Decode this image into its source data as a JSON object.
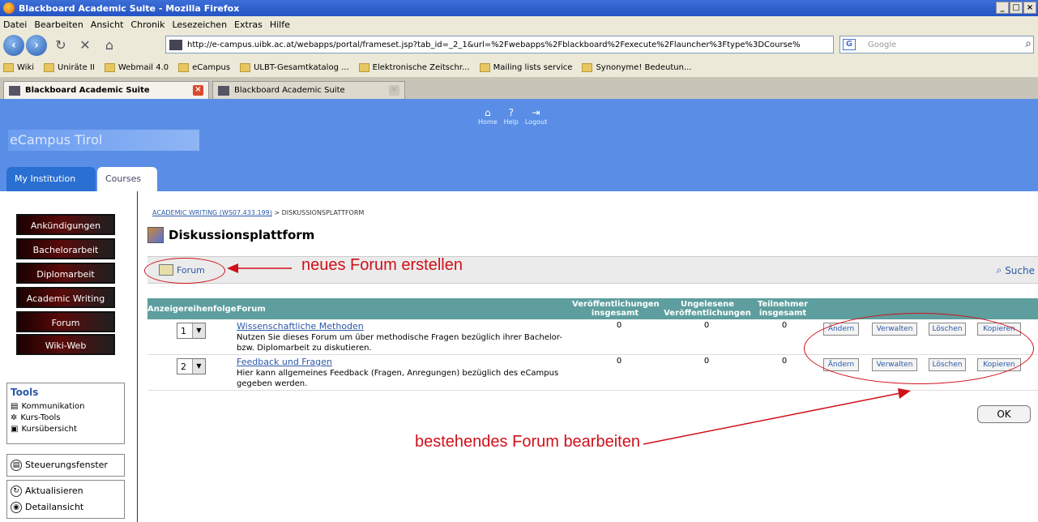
{
  "window": {
    "title": "Blackboard Academic Suite - Mozilla Firefox",
    "controls": [
      "_",
      "□",
      "×"
    ]
  },
  "menubar": [
    "Datei",
    "Bearbeiten",
    "Ansicht",
    "Chronik",
    "Lesezeichen",
    "Extras",
    "Hilfe"
  ],
  "navbar": {
    "url": "http://e-campus.uibk.ac.at/webapps/portal/frameset.jsp?tab_id=_2_1&url=%2Fwebapps%2Fblackboard%2Fexecute%2Flauncher%3Ftype%3DCourse%",
    "search_placeholder": "Google"
  },
  "bookmarks": [
    "Wiki",
    "Uniräte II",
    "Webmail 4.0",
    "eCampus",
    "ULBT-Gesamtkatalog ...",
    "Elektronische Zeitschr...",
    "Mailing lists service",
    "Synonyme! Bedeutun..."
  ],
  "tabs": [
    {
      "label": "Blackboard Academic Suite"
    },
    {
      "label": "Blackboard Academic Suite"
    }
  ],
  "header": {
    "logo": "eCampus Tirol",
    "toplinks": [
      {
        "label": "Home",
        "icon": "home-icon"
      },
      {
        "label": "Help",
        "icon": "help-icon"
      },
      {
        "label": "Logout",
        "icon": "logout-icon"
      }
    ],
    "navtabs": [
      "My Institution",
      "Courses"
    ]
  },
  "course_menu": [
    "Ankündigungen",
    "Bachelorarbeit",
    "Diplomarbeit",
    "Academic Writing",
    "Forum",
    "Wiki-Web"
  ],
  "tools": {
    "title": "Tools",
    "items": [
      "Kommunikation",
      "Kurs-Tools",
      "Kursübersicht"
    ]
  },
  "side_buttons": {
    "control_panel": "Steuerungsfenster",
    "refresh": "Aktualisieren",
    "detail_view": "Detailansicht"
  },
  "breadcrumb": {
    "course": "ACADEMIC WRITING (WS07.433.199)",
    "separator": ">",
    "current": "DISKUSSIONSPLATTFORM"
  },
  "page_title": "Diskussionsplattform",
  "actions": {
    "forum": "Forum",
    "search": "Suche"
  },
  "annotations": {
    "new_forum": "neues Forum erstellen",
    "edit_forum": "bestehendes Forum bearbeiten",
    "color": "#d0101a"
  },
  "table": {
    "headers": {
      "order": "Anzeigereihenfolge",
      "forum": "Forum",
      "posts": "Veröffentlichungen insgesamt",
      "unread": "Ungelesene Veröffentlichungen",
      "participants": "Teilnehmer insgesamt"
    },
    "rows": [
      {
        "order": "1",
        "title": "Wissenschaftliche Methoden",
        "desc": "Nutzen Sie dieses Forum um über methodische Fragen bezüglich ihrer Bachelor- bzw. Diplomarbeit zu diskutieren.",
        "posts": "0",
        "unread": "0",
        "participants": "0"
      },
      {
        "order": "2",
        "title": "Feedback und Fragen",
        "desc": "Hier kann allgemeines Feedback (Fragen, Anregungen) bezüglich des eCampus gegeben werden.",
        "posts": "0",
        "unread": "0",
        "participants": "0"
      }
    ],
    "row_buttons": [
      "Ändern",
      "Verwalten",
      "Löschen",
      "Kopieren"
    ]
  },
  "ok": "OK",
  "colors": {
    "header_blue": "#5a8ee6",
    "table_header": "#5e9e9e",
    "link": "#2b59a8"
  }
}
